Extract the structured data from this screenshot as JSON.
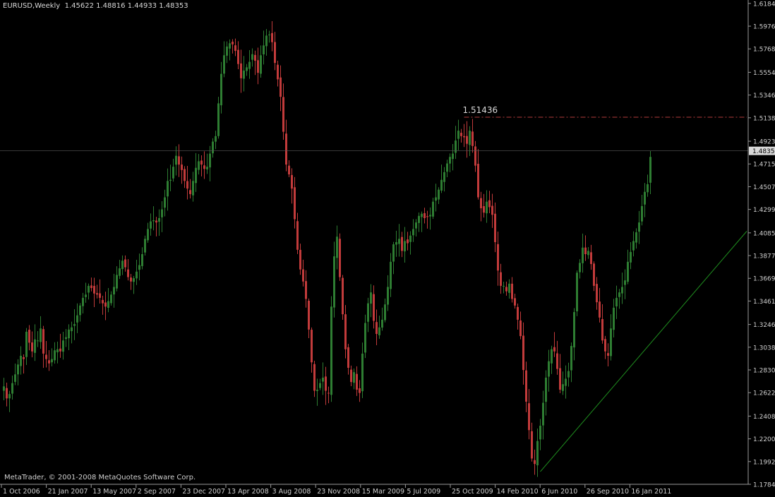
{
  "header": {
    "symbol": "EURUSD,Weekly",
    "open": "1.45622",
    "high": "1.48816",
    "low": "1.44933",
    "close": "1.48353"
  },
  "copyright": "MetaTrader, © 2001-2008 MetaQuotes Software Corp.",
  "colors": {
    "background": "#000000",
    "bull": "#2e7d32",
    "bear": "#c23b3b",
    "grid": "#3a3a3a",
    "resistance": "#b23b3b",
    "trendline": "#1f8f1f"
  },
  "chart_data": {
    "type": "candlestick",
    "title": "",
    "xlabel": "",
    "ylabel": "",
    "ylim": [
      1.1784,
      1.619
    ],
    "y_ticks": [
      "1.61845",
      "1.59765",
      "1.57685",
      "1.55540",
      "1.53460",
      "1.51380",
      "1.49235",
      "1.47155",
      "1.45075",
      "1.42995",
      "1.40850",
      "1.38770",
      "1.36690",
      "1.34610",
      "1.32465",
      "1.30385",
      "1.28305",
      "1.26225",
      "1.24080",
      "1.22000",
      "1.19920",
      "1.17840"
    ],
    "x_ticks": [
      "1 Oct 2006",
      "21 Jan 2007",
      "13 May 2007",
      "2 Sep 2007",
      "23 Dec 2007",
      "13 Apr 2008",
      "3 Aug 2008",
      "23 Nov 2008",
      "15 Mar 2009",
      "5 Jul 2009",
      "25 Oct 2009",
      "14 Feb 2010",
      "6 Jun 2010",
      "26 Sep 2010",
      "16 Jan 2011"
    ],
    "current_price": "1.48353",
    "resistance": {
      "value": 1.51436,
      "label": "1.51436",
      "from_index": 163
    },
    "trendline": {
      "from_index": 190,
      "from_value": 1.19,
      "to_value": 1.41
    },
    "series_close": [
      1.268,
      1.257,
      1.261,
      1.271,
      1.279,
      1.288,
      1.296,
      1.293,
      1.318,
      1.308,
      1.3,
      1.311,
      1.31,
      1.321,
      1.298,
      1.293,
      1.289,
      1.293,
      1.301,
      1.302,
      1.3,
      1.31,
      1.313,
      1.32,
      1.322,
      1.325,
      1.333,
      1.342,
      1.349,
      1.352,
      1.36,
      1.358,
      1.353,
      1.352,
      1.349,
      1.344,
      1.341,
      1.346,
      1.352,
      1.359,
      1.37,
      1.376,
      1.383,
      1.377,
      1.368,
      1.364,
      1.367,
      1.373,
      1.379,
      1.389,
      1.403,
      1.412,
      1.419,
      1.42,
      1.418,
      1.422,
      1.43,
      1.441,
      1.456,
      1.457,
      1.469,
      1.479,
      1.471,
      1.466,
      1.456,
      1.449,
      1.444,
      1.456,
      1.468,
      1.474,
      1.471,
      1.467,
      1.469,
      1.481,
      1.492,
      1.497,
      1.527,
      1.554,
      1.571,
      1.579,
      1.582,
      1.581,
      1.575,
      1.563,
      1.55,
      1.557,
      1.56,
      1.565,
      1.572,
      1.566,
      1.555,
      1.571,
      1.58,
      1.589,
      1.59,
      1.583,
      1.564,
      1.549,
      1.533,
      1.501,
      1.471,
      1.462,
      1.449,
      1.421,
      1.393,
      1.375,
      1.364,
      1.348,
      1.32,
      1.29,
      1.264,
      1.265,
      1.271,
      1.276,
      1.264,
      1.262,
      1.341,
      1.387,
      1.405,
      1.368,
      1.334,
      1.302,
      1.285,
      1.272,
      1.281,
      1.265,
      1.262,
      1.298,
      1.326,
      1.344,
      1.354,
      1.328,
      1.316,
      1.322,
      1.329,
      1.343,
      1.359,
      1.382,
      1.398,
      1.4,
      1.403,
      1.392,
      1.401,
      1.399,
      1.406,
      1.412,
      1.418,
      1.424,
      1.426,
      1.422,
      1.423,
      1.425,
      1.437,
      1.441,
      1.448,
      1.457,
      1.464,
      1.472,
      1.478,
      1.481,
      1.493,
      1.502,
      1.497,
      1.496,
      1.49,
      1.502,
      1.488,
      1.47,
      1.441,
      1.431,
      1.427,
      1.437,
      1.432,
      1.425,
      1.4,
      1.374,
      1.36,
      1.36,
      1.355,
      1.362,
      1.348,
      1.342,
      1.329,
      1.314,
      1.283,
      1.254,
      1.228,
      1.202,
      1.197,
      1.218,
      1.232,
      1.253,
      1.276,
      1.291,
      1.302,
      1.3,
      1.284,
      1.265,
      1.27,
      1.275,
      1.282,
      1.305,
      1.336,
      1.372,
      1.381,
      1.395,
      1.389,
      1.392,
      1.38,
      1.36,
      1.345,
      1.331,
      1.31,
      1.3,
      1.296,
      1.321,
      1.34,
      1.349,
      1.354,
      1.359,
      1.365,
      1.382,
      1.391,
      1.401,
      1.409,
      1.418,
      1.433,
      1.446,
      1.453,
      1.478
    ]
  }
}
